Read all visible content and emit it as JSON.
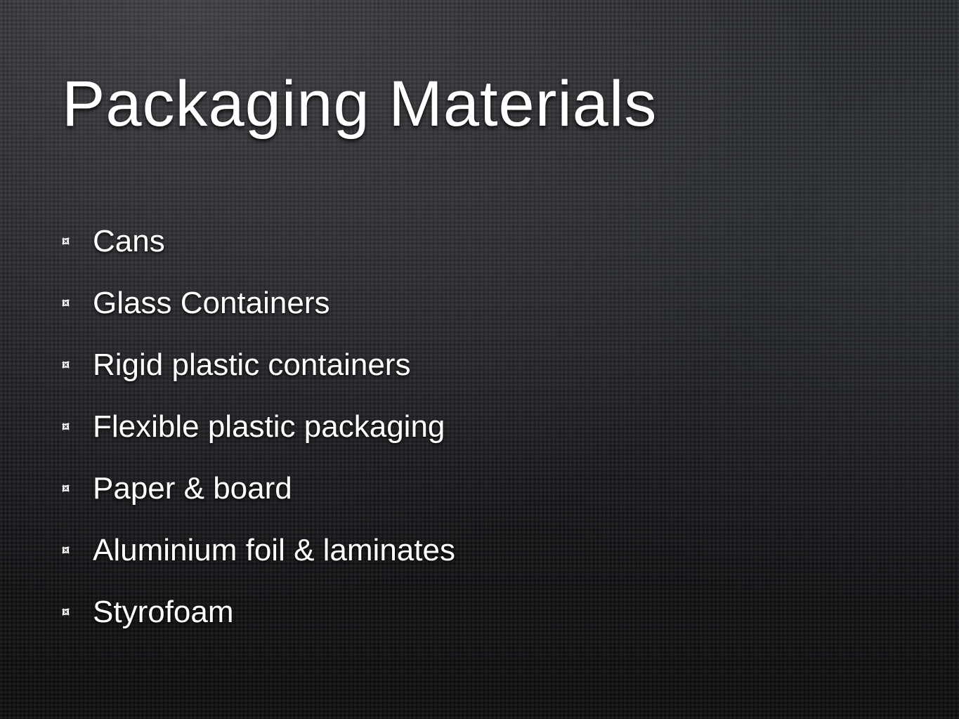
{
  "slide": {
    "title": "Packaging Materials",
    "bullet_icon": "sketch-square-bullet-icon",
    "text_color": "#ffffff",
    "items": [
      {
        "label": "Cans"
      },
      {
        "label": "Glass Containers"
      },
      {
        "label": "Rigid plastic containers"
      },
      {
        "label": "Flexible plastic packaging"
      },
      {
        "label": "Paper & board"
      },
      {
        "label": "Aluminium foil & laminates"
      },
      {
        "label": "Styrofoam"
      }
    ]
  }
}
